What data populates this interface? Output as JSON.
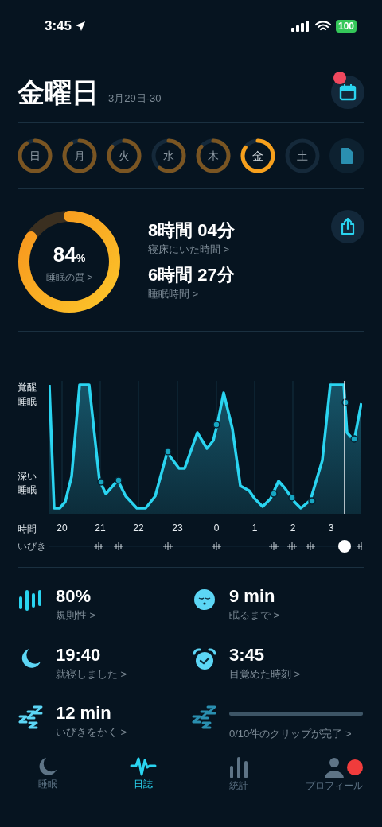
{
  "status_bar": {
    "time": "3:45",
    "battery": "100"
  },
  "header": {
    "title": "金曜日",
    "date_range": "3月29日-30",
    "calendar_badge": true
  },
  "days": [
    {
      "label": "日",
      "selected": false
    },
    {
      "label": "月",
      "selected": false
    },
    {
      "label": "火",
      "selected": false
    },
    {
      "label": "水",
      "selected": false
    },
    {
      "label": "木",
      "selected": false
    },
    {
      "label": "金",
      "selected": true
    },
    {
      "label": "土",
      "selected": false
    }
  ],
  "summary": {
    "quality": {
      "value": "84",
      "unit": "%",
      "label": "睡眠の質 >",
      "level": 0.84
    },
    "metrics": [
      {
        "value": "8時間 04分",
        "label": "寝床にいた時間 >"
      },
      {
        "value": "6時間 27分",
        "label": "睡眠時間 >"
      }
    ]
  },
  "sleep_graph": {
    "stage_labels": [
      "覚醒",
      "睡眠",
      "深い睡眠"
    ],
    "time_label": "時間",
    "time_ticks": [
      "20",
      "21",
      "22",
      "23",
      "0",
      "1",
      "2",
      "3"
    ],
    "snore_label": "いびき"
  },
  "stats": [
    {
      "kind": "bars",
      "value": "80%",
      "label": "規則性 >"
    },
    {
      "kind": "face",
      "value": "9 min",
      "label": "眠るまで >"
    },
    {
      "kind": "moon",
      "value": "19:40",
      "label": "就寝しました >"
    },
    {
      "kind": "alarm",
      "value": "3:45",
      "label": "目覚めた時刻 >"
    },
    {
      "kind": "snore",
      "value": "12 min",
      "label": "いびきをかく >"
    },
    {
      "kind": "progress",
      "label": "0/10件のクリップが完了 >"
    }
  ],
  "tabs": [
    {
      "kind": "moon",
      "label": "睡眠",
      "selected": false,
      "badge": false
    },
    {
      "kind": "wave",
      "label": "日誌",
      "selected": true,
      "badge": false
    },
    {
      "kind": "bars",
      "label": "統計",
      "selected": false,
      "badge": false
    },
    {
      "kind": "person",
      "label": "プロフィール",
      "selected": false,
      "badge": true
    }
  ]
}
